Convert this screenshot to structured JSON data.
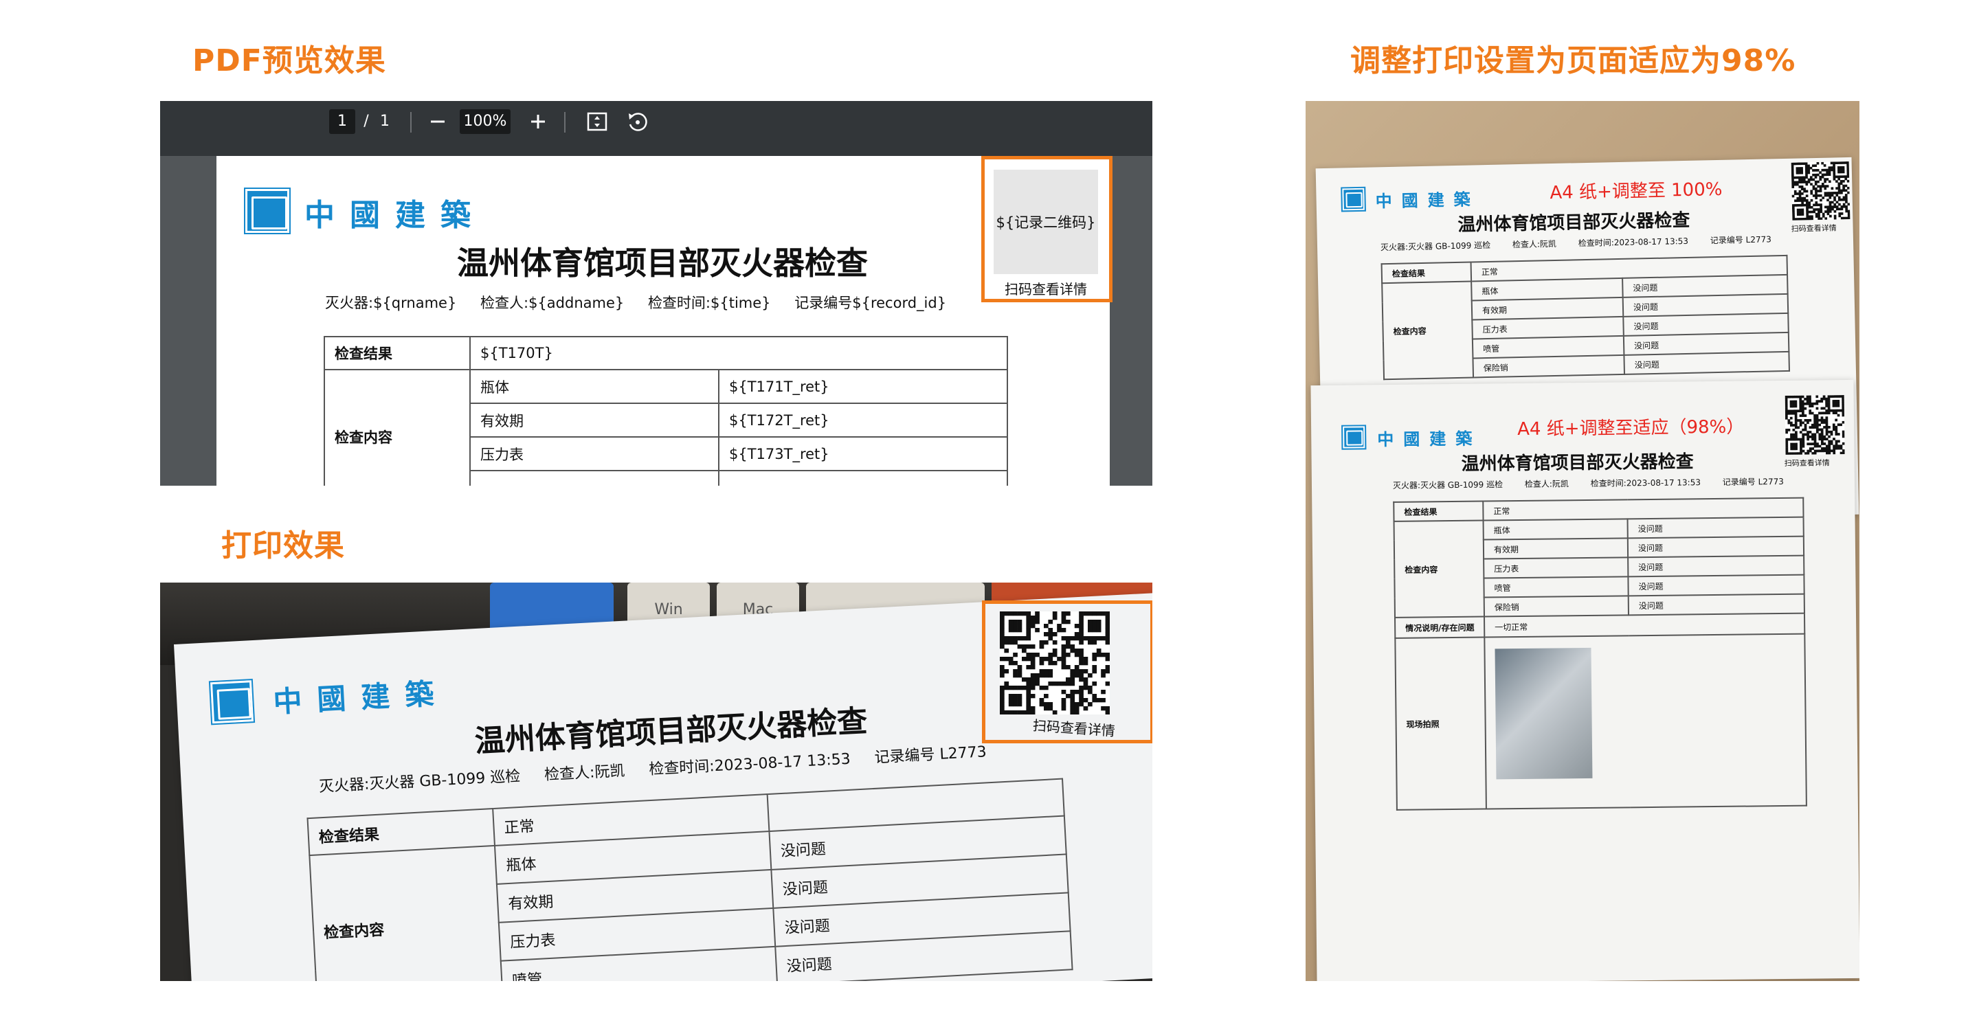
{
  "titles": {
    "pdf_preview": "PDF预览效果",
    "print_effect": "打印效果",
    "adjust_print": "调整打印设置为页面适应为98%"
  },
  "viewer": {
    "page_current": "1",
    "page_sep": "/",
    "page_total": "1",
    "zoom": "100%",
    "icons": [
      "minus-icon",
      "plus-icon",
      "fit-page-icon",
      "rotate-icon"
    ]
  },
  "template_doc": {
    "logo_text": "中國建築",
    "title": "温州体育馆项目部灭火器检查",
    "meta": {
      "extinguisher": "灭火器:${qrname}",
      "inspector": "检查人:${addname}",
      "time": "检查时间:${time}",
      "record": "记录编号${record_id}"
    },
    "qr_placeholder": "${记录二维码}",
    "qr_caption": "扫码查看详情",
    "table": {
      "result_label": "检查结果",
      "result_value": "${T170T}",
      "content_label": "检查内容",
      "rows": [
        {
          "item": "瓶体",
          "value": "${T171T_ret}"
        },
        {
          "item": "有效期",
          "value": "${T172T_ret}"
        },
        {
          "item": "压力表",
          "value": "${T173T_ret}"
        }
      ]
    }
  },
  "printed_doc": {
    "logo_text": "中國建築",
    "title": "温州体育馆项目部灭火器检查",
    "meta": {
      "extinguisher": "灭火器:灭火器 GB-1099 巡检",
      "inspector": "检查人:阮凯",
      "time": "检查时间:2023-08-17 13:53",
      "record": "记录编号 L2773"
    },
    "qr_caption": "扫码查看详情",
    "table": {
      "result_label": "检查结果",
      "result_value": "正常",
      "content_label": "检查内容",
      "rows": [
        {
          "item": "瓶体",
          "value": "没问题"
        },
        {
          "item": "有效期",
          "value": "没问题"
        },
        {
          "item": "压力表",
          "value": "没问题"
        },
        {
          "item": "喷管",
          "value": "没问题"
        },
        {
          "item": "保险销",
          "value": "没问题"
        }
      ],
      "notes_label": "情况说明/存在问题",
      "notes_value": "一切正常",
      "photo_label": "现场拍照"
    },
    "keyboard_keys": [
      "Win",
      "Mac"
    ]
  },
  "notes": {
    "a4_100": "A4 纸+调整至 100%",
    "a4_98": "A4 纸+调整至适应（98%）"
  },
  "colors": {
    "accent": "#f07c1c",
    "logo_blue": "#1689cd",
    "red_note": "#e8261f",
    "toolbar": "#323639",
    "viewer_bg": "#525659"
  }
}
